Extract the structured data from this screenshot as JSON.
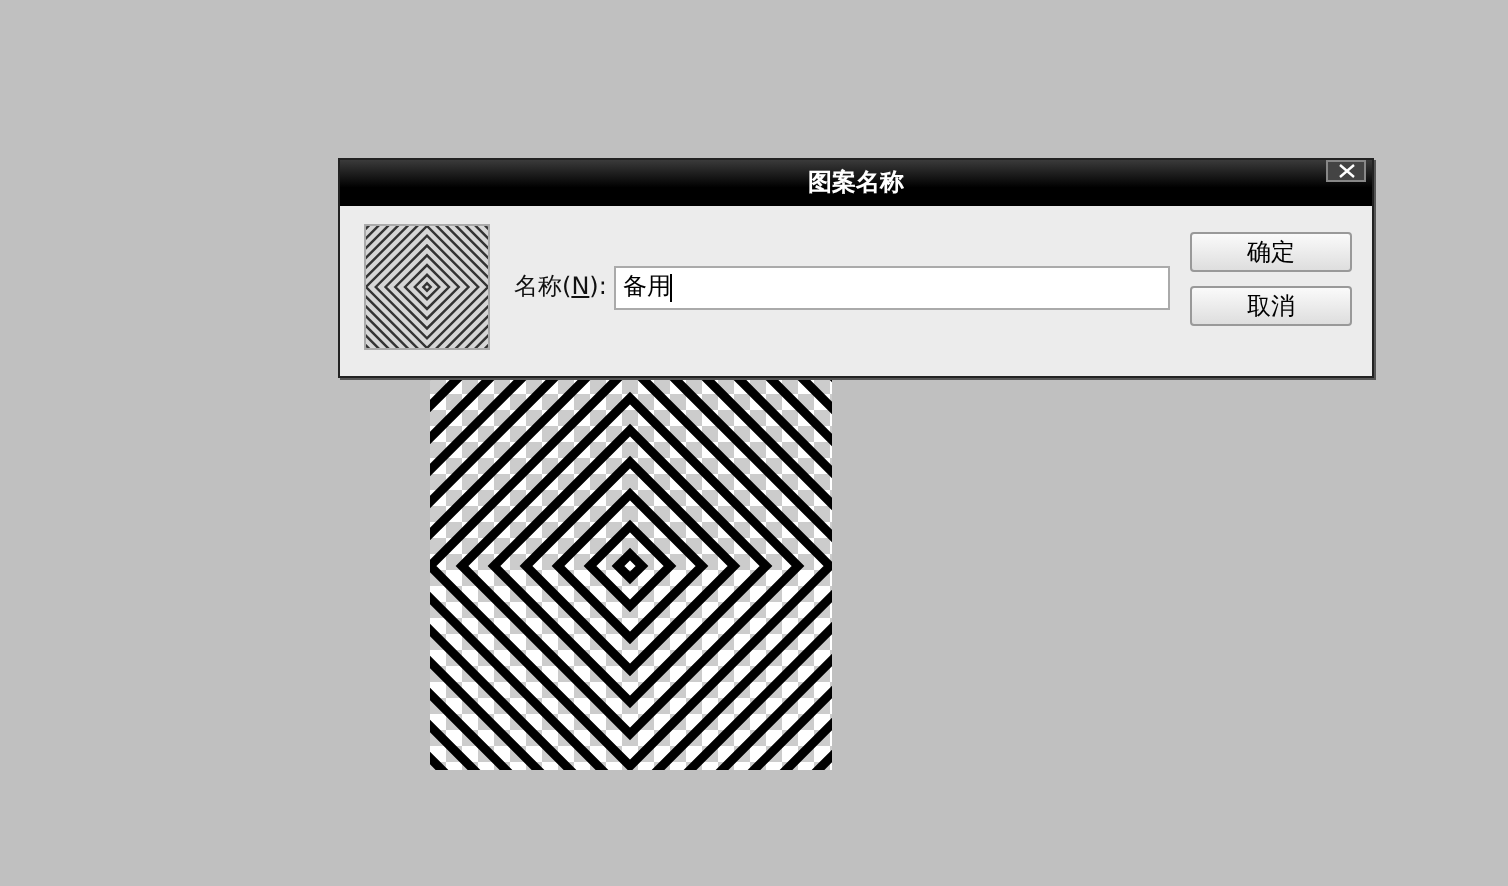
{
  "dialog": {
    "title": "图案名称",
    "name_field": {
      "label_before": "名称(",
      "mnemonic": "N",
      "label_after": "):",
      "value": "备用"
    },
    "buttons": [
      {
        "label": "确定"
      },
      {
        "label": "取消"
      }
    ]
  }
}
